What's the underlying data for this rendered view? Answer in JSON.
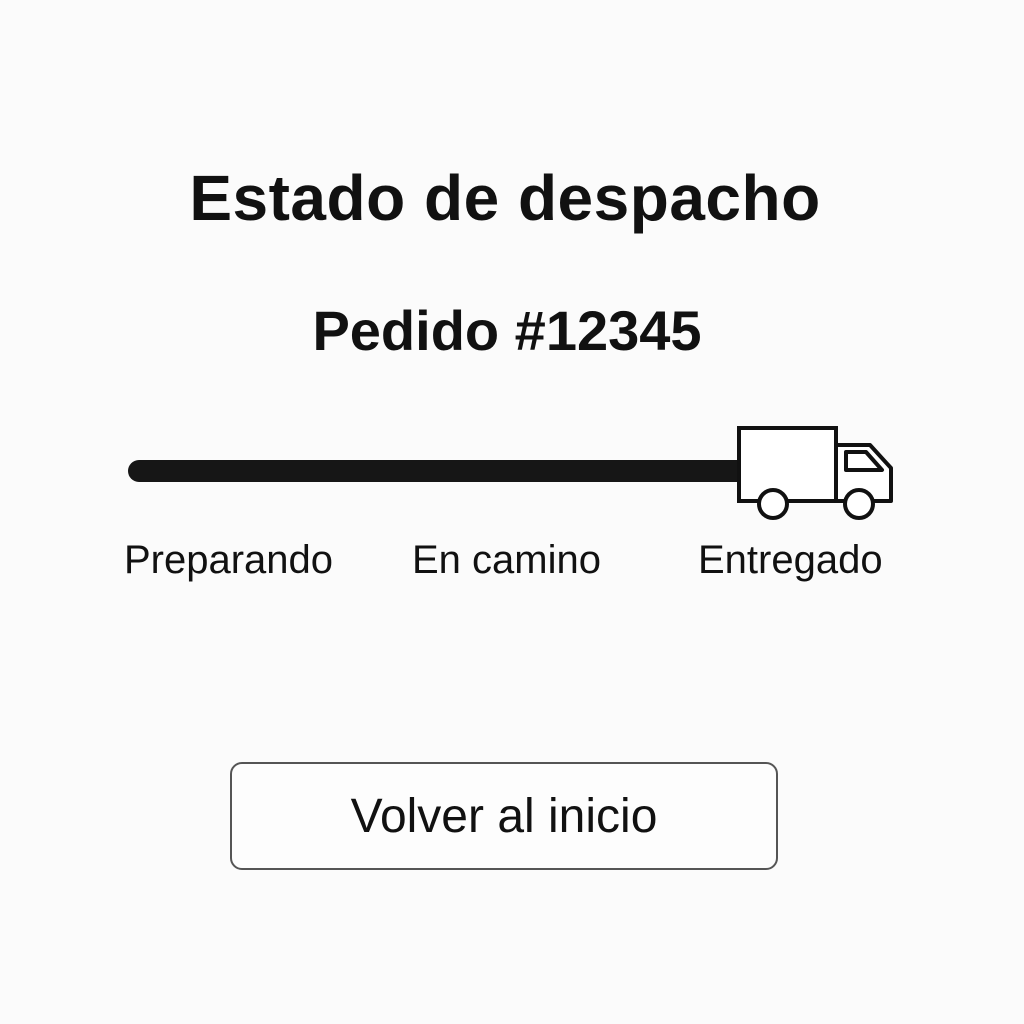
{
  "header": {
    "title": "Estado de despacho"
  },
  "order": {
    "label": "Pedido #12345"
  },
  "tracking": {
    "current_stage": "Entregado",
    "progress": 1.0,
    "icon": "truck-icon",
    "stages": [
      {
        "label": "Preparando"
      },
      {
        "label": "En camino"
      },
      {
        "label": "Entregado"
      }
    ]
  },
  "actions": {
    "back_label": "Volver al inicio"
  },
  "colors": {
    "background": "#fbfbfb",
    "text": "#111111",
    "track": "#161616",
    "button_border": "#555555"
  }
}
